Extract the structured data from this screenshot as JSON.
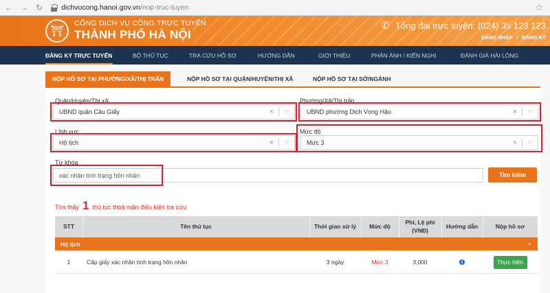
{
  "browser": {
    "host": "dichvucong.hanoi.gov.vn",
    "path": "/nop-truc-tuyen"
  },
  "header": {
    "title_line1": "CỔNG DỊCH VỤ CÔNG TRỰC TUYẾN",
    "title_line2": "THÀNH PHỐ HÀ NỘI",
    "hotline": "Tổng đài trực tuyến: (024) 35 123 123",
    "login": "ĐĂNG NHẬP",
    "register": "ĐĂNG KÝ",
    "auth_separator": "/"
  },
  "nav": {
    "items": [
      "ĐĂNG KÝ TRỰC TUYẾN",
      "BỘ THỦ TỤC",
      "TRA CỨU HỒ SƠ",
      "HƯỚNG DẪN",
      "GIỚI THIỆU",
      "PHẢN ÁNH / KIẾN NGHỊ",
      "ĐÁNH GIÁ HÀI LÒNG"
    ]
  },
  "tabs": [
    "NỘP HỒ SƠ TẠI PHƯỜNG/XÃ/THỊ TRẤN",
    "NỘP HỒ SƠ TẠI QUẬN/HUYỆN/THỊ XÃ",
    "NỘP HỒ SƠ TẠI SỞ/NGÀNH"
  ],
  "form": {
    "district_label": "Quận/Huyện/Thị xã",
    "district_value": "UBND quận Cầu Giấy",
    "ward_label": "Phường/Xã/Thị trấn",
    "ward_value": "UBND phường Dịch Vọng Hậu",
    "field_label": "Lĩnh vực",
    "field_value": "Hộ tịch",
    "level_label": "Mức độ",
    "level_value": "Mức 3",
    "keyword_label": "Từ khóa",
    "keyword_value": "xác nhận tình trạng hôn nhân",
    "search_button": "Tìm kiếm"
  },
  "result": {
    "prefix": "Tìm thấy",
    "count": "1",
    "suffix": "thủ tục thoả mãn điều kiện tra cứu"
  },
  "table": {
    "headers": {
      "stt": "STT",
      "name": "Tên thủ tục",
      "time": "Thời gian xử lý",
      "level": "Mức độ",
      "fee_line1": "Phí, Lệ phí",
      "fee_line2": "(VNĐ)",
      "guide": "Hướng dẫn",
      "submit": "Nộp hồ sơ"
    },
    "group": "Hộ tịch",
    "rows": [
      {
        "stt": "1",
        "name": "Cấp giấy xác nhận tình trạng hôn nhân",
        "time": "3 ngày",
        "level": "Mức 3",
        "fee": "3,000",
        "action": "Thực hiện"
      }
    ]
  },
  "colors": {
    "brand_orange": "#e8731b",
    "nav_navy": "#1d3450",
    "highlight_red": "#e21c2a",
    "action_green": "#3fa34d"
  }
}
